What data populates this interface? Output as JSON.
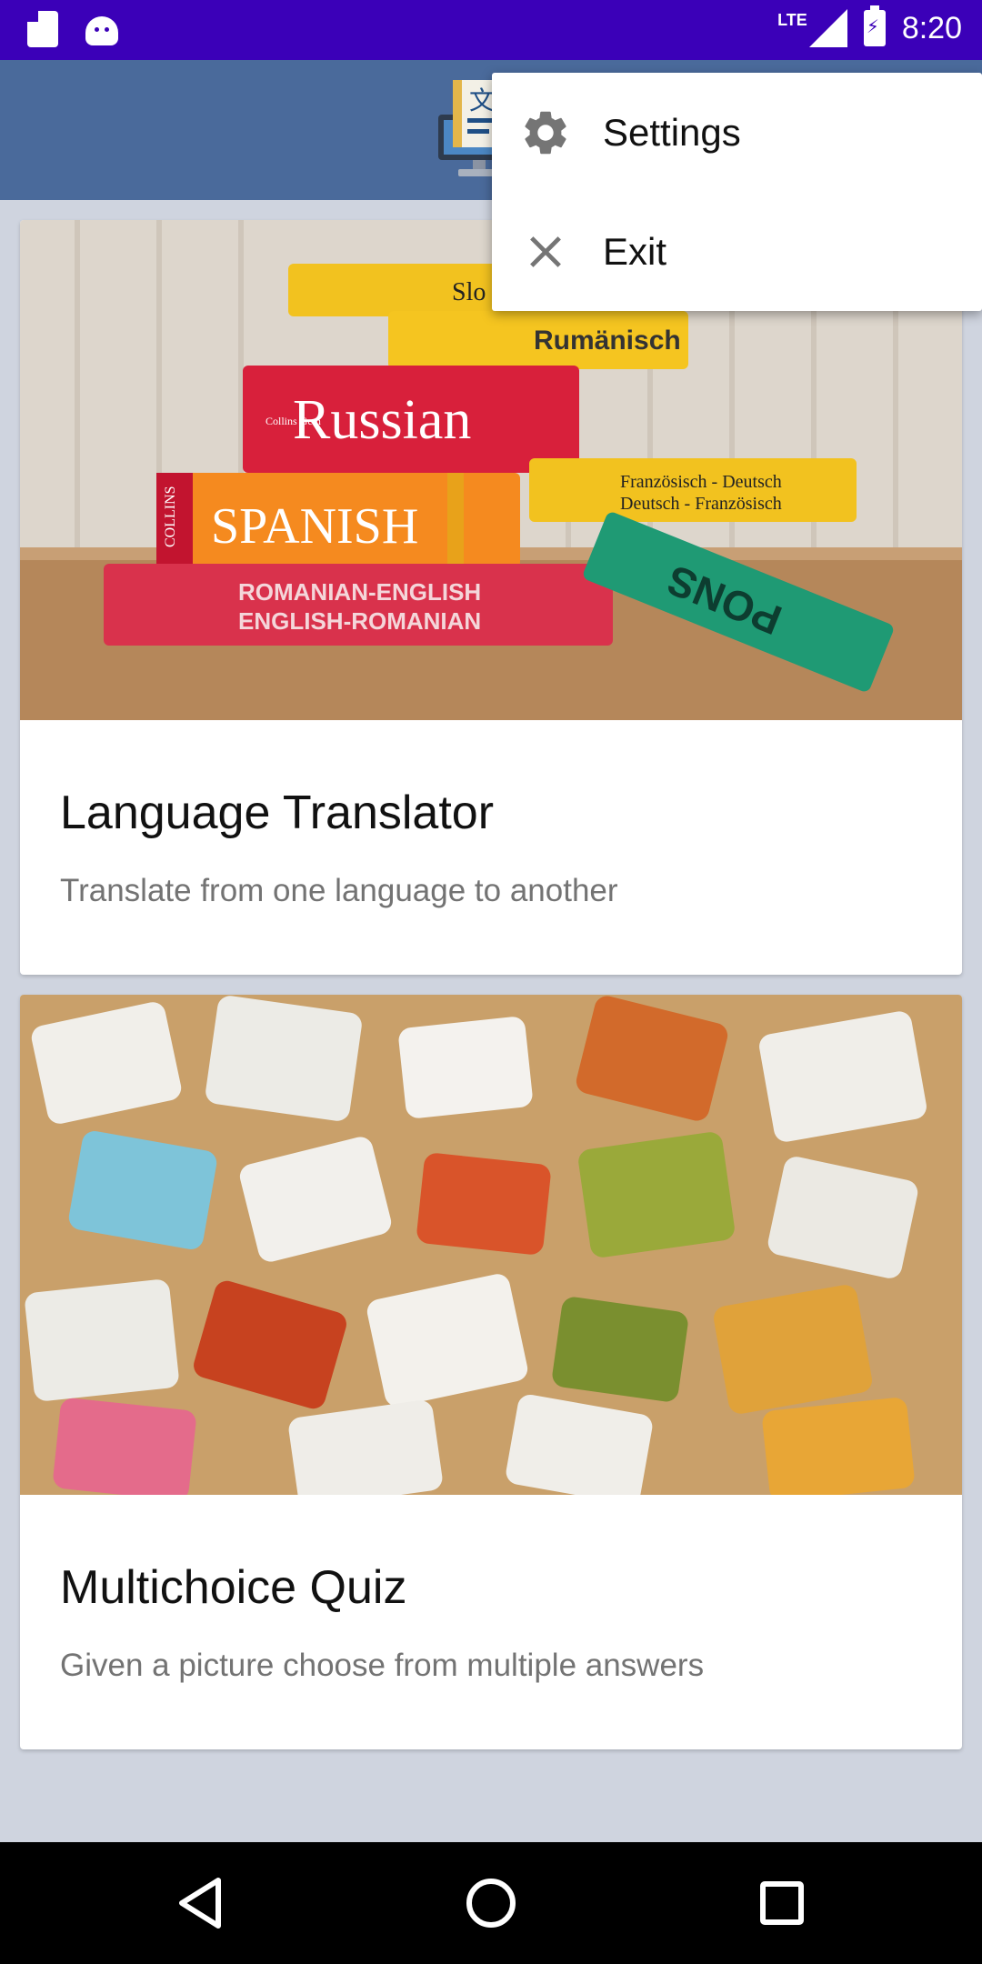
{
  "status_bar": {
    "network": "LTE",
    "time": "8:20",
    "icons": [
      "sd-card-icon",
      "android-icon",
      "signal-icon",
      "battery-charging-icon"
    ]
  },
  "app_bar": {
    "logo_icon": "translator-monitor-icon",
    "logo_glyph": "文"
  },
  "cards": [
    {
      "title": "Language Translator",
      "subtitle": "Translate from one language to another",
      "image_icon": "dictionaries-photo",
      "books": [
        "Slo",
        "Rumänisch",
        "Russian",
        "SPANISH",
        "Französisch - Deutsch",
        "Deutsch - Französisch",
        "ROMANIAN-ENGLISH",
        "ENGLISH-ROMANIAN",
        "PONS",
        "COLLINS",
        "Collins Gem"
      ]
    },
    {
      "title": "Multichoice Quiz",
      "subtitle": "Given a picture choose from multiple answers",
      "image_icon": "puzzle-pieces-photo"
    }
  ],
  "menu": {
    "items": [
      {
        "label": "Settings",
        "icon": "gear-icon"
      },
      {
        "label": "Exit",
        "icon": "close-icon"
      }
    ]
  },
  "nav": {
    "icons": [
      "back-icon",
      "home-icon",
      "recents-icon"
    ]
  },
  "colors": {
    "status_bar": "#3b00b8",
    "app_bar": "#4a6a9b",
    "background": "#cfd4df"
  }
}
